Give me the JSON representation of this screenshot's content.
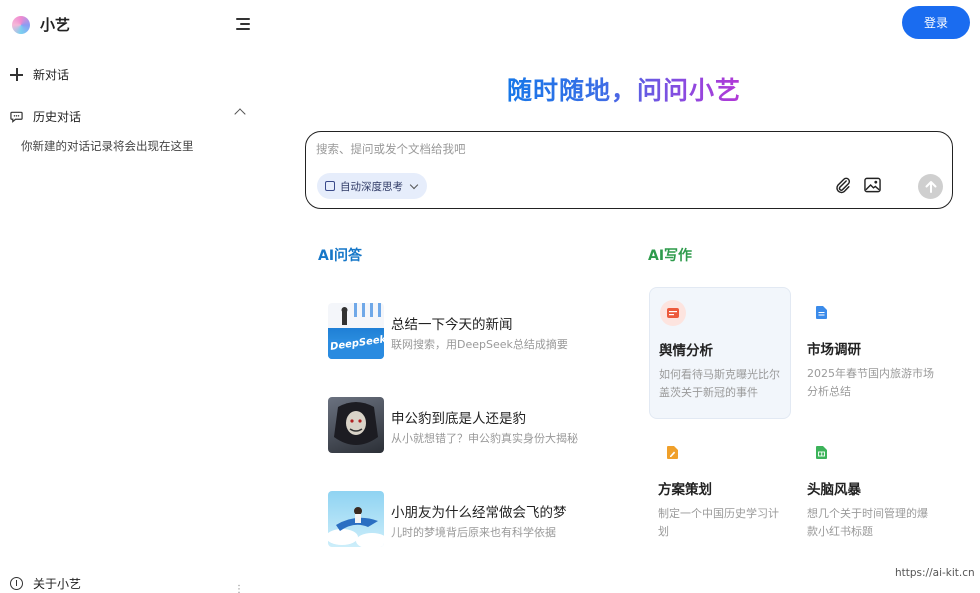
{
  "sidebar": {
    "brand_name": "小艺",
    "new_chat_label": "新对话",
    "history_label": "历史对话",
    "history_empty_text": "你新建的对话记录将会出现在这里",
    "about_label": "关于小艺"
  },
  "header": {
    "login_label": "登录"
  },
  "hero": {
    "title": "随时随地，问问小艺"
  },
  "search": {
    "placeholder": "搜索、提问或发个文档给我吧",
    "think_chip_label": "自动深度思考"
  },
  "qa": {
    "title": "AI问答",
    "items": [
      {
        "question": "总结一下今天的新闻",
        "subtitle": "联网搜索，用DeepSeek总结成摘要",
        "thumb_text": "DeepSeek"
      },
      {
        "question": "申公豹到底是人还是豹",
        "subtitle": "从小就想错了？申公豹真实身份大揭秘"
      },
      {
        "question": "小朋友为什么经常做会飞的梦",
        "subtitle": "儿时的梦境背后原来也有科学依据"
      }
    ]
  },
  "writing": {
    "title": "AI写作",
    "cards": [
      {
        "title": "舆情分析",
        "desc": "如何看待马斯克曝光比尔盖茨关于新冠的事件",
        "icon": "news-icon"
      },
      {
        "title": "市场调研",
        "desc": "2025年春节国内旅游市场分析总结",
        "icon": "document-icon"
      },
      {
        "title": "方案策划",
        "desc": "制定一个中国历史学习计划",
        "icon": "pencil-document-icon"
      },
      {
        "title": "头脑风暴",
        "desc": "想几个关于时间管理的爆款小红书标题",
        "icon": "sheet-icon"
      }
    ]
  },
  "watermark": "https://ai-kit.cn",
  "colors": {
    "accent_blue": "#1a6cf0",
    "qa_title": "#1677c8",
    "write_title": "#2e9b4c"
  }
}
